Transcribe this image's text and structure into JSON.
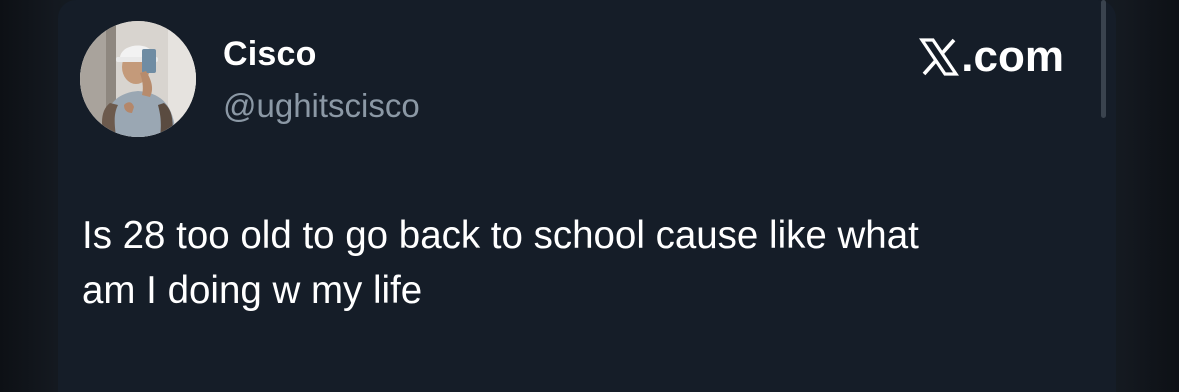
{
  "author": {
    "display_name": "Cisco",
    "handle": "@ughitscisco",
    "avatar_icon": "profile-photo"
  },
  "brand": {
    "site": ".com",
    "icon": "x-logo-icon"
  },
  "tweet": {
    "line1": "Is 28 too old to go back to school cause like what",
    "line2": "am I doing w my life"
  },
  "colors": {
    "background": "#11151b",
    "card": "#151d28",
    "text_primary": "#ffffff",
    "text_secondary": "#8b98a5"
  }
}
